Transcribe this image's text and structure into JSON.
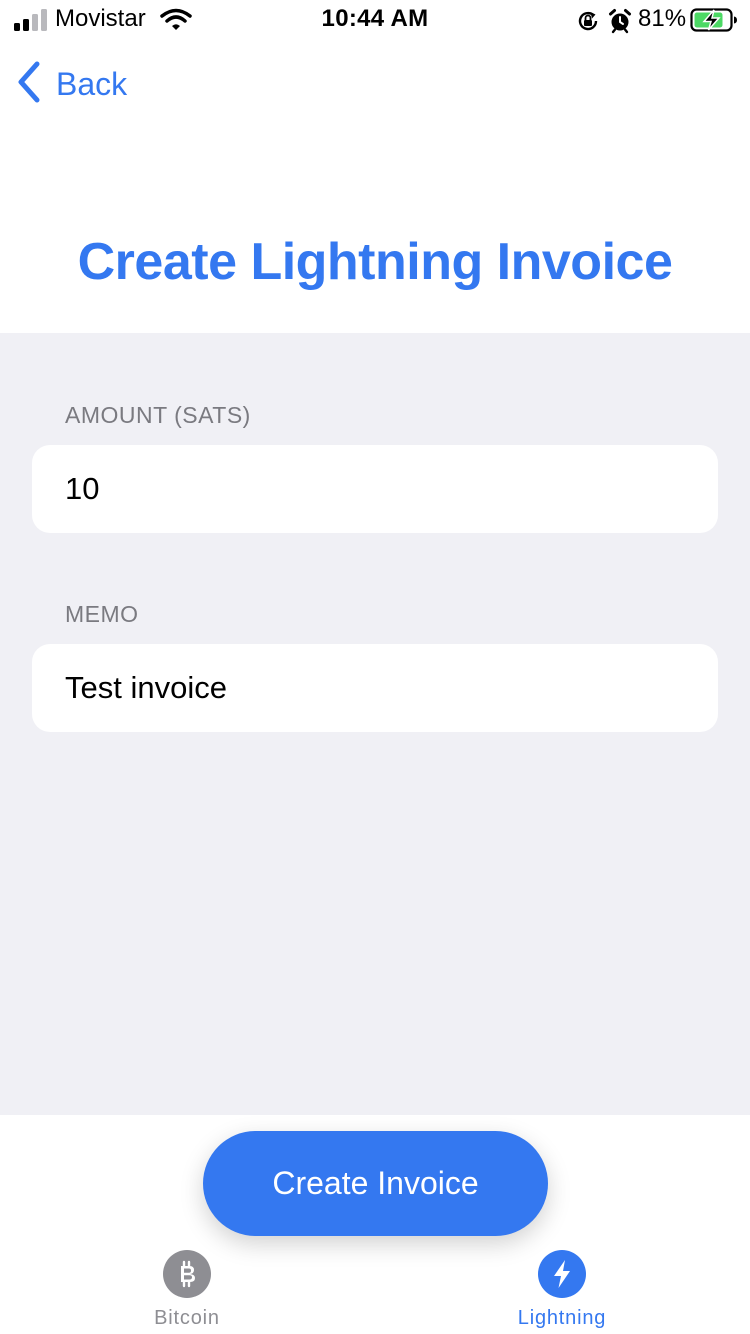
{
  "status_bar": {
    "carrier": "Movistar",
    "time": "10:44 AM",
    "battery_percent": "81%",
    "signal_bars_active": 2,
    "signal_bars_total": 4,
    "battery_level": 0.81,
    "icons": [
      "signal-icon",
      "wifi-icon",
      "rotation-lock-icon",
      "alarm-icon",
      "battery-charging-icon"
    ]
  },
  "nav": {
    "back_label": "Back",
    "back_icon": "chevron-left-icon"
  },
  "title": "Create Lightning Invoice",
  "form": {
    "amount": {
      "label": "AMOUNT (SATS)",
      "value": "10"
    },
    "memo": {
      "label": "MEMO",
      "value": "Test invoice"
    }
  },
  "create_button": {
    "label": "Create Invoice"
  },
  "tabs": [
    {
      "label": "Bitcoin",
      "icon": "bitcoin-icon",
      "active": false
    },
    {
      "label": "Lightning",
      "icon": "lightning-icon",
      "active": true
    }
  ],
  "colors": {
    "accent": "#3478f0",
    "form_background": "#f0f0f5",
    "label_gray": "#7a7a80",
    "inactive_tab": "#8e8e93",
    "battery_green": "#4cd964"
  }
}
